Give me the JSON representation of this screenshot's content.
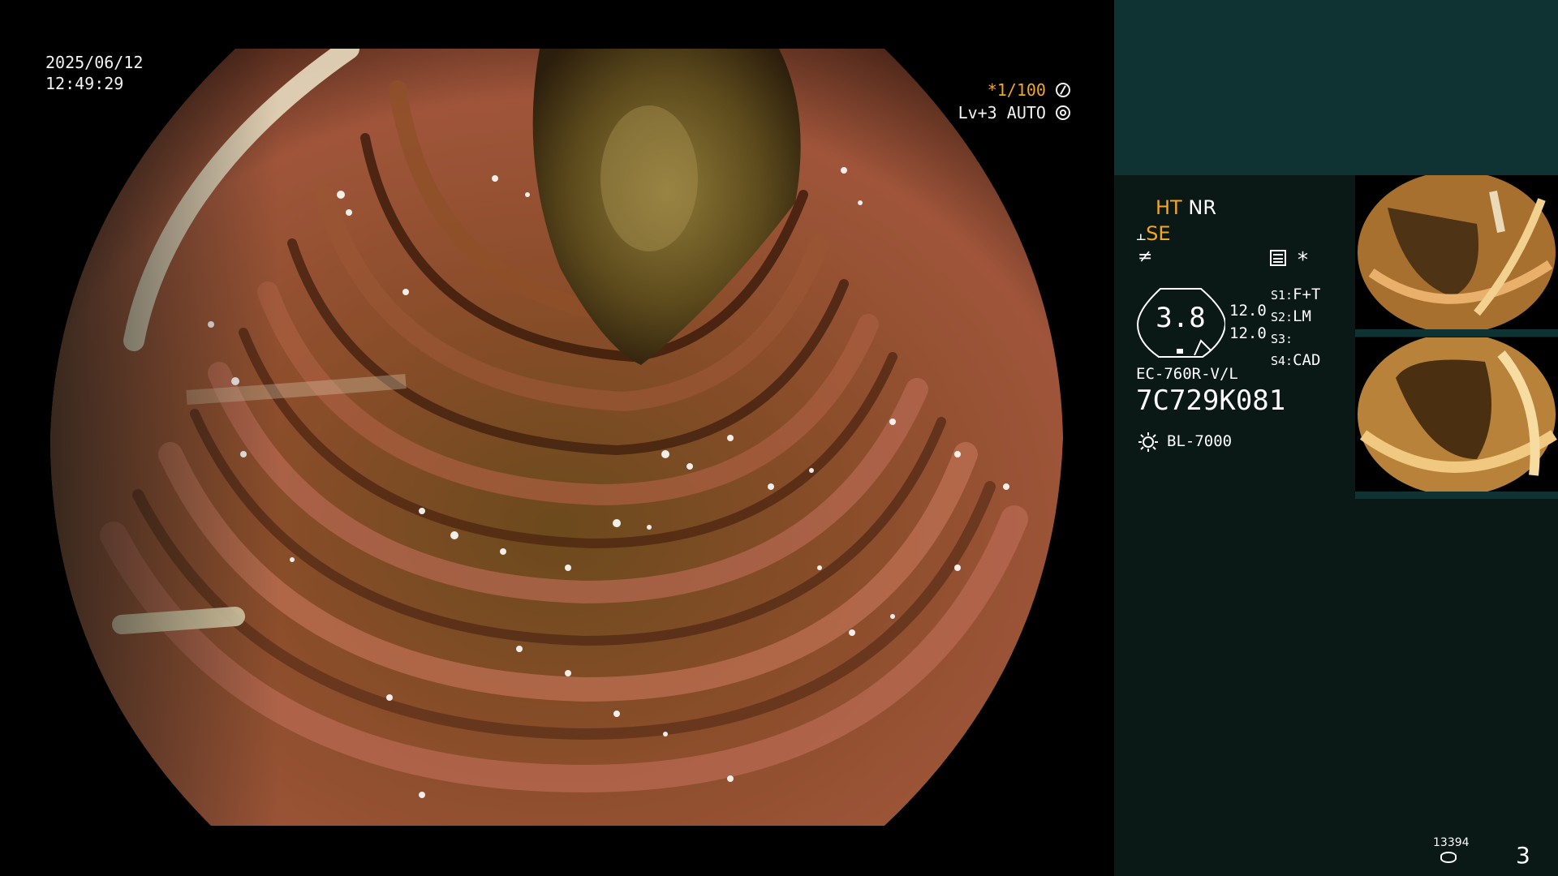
{
  "overlay": {
    "date": "2025/06/12",
    "time": "12:49:29",
    "shutter": "*1/100",
    "shutter_icon": "aperture-icon",
    "level": "Lv+3",
    "mode": "AUTO",
    "mode_icon": "iris-icon"
  },
  "panel": {
    "ht": "HT",
    "nr": "NR",
    "se": "SE",
    "se_icon": "se-symbol-icon",
    "f_icon": "f-symbol-icon",
    "memo_icon": "document-icon",
    "star": "*",
    "dial_value": "3.8",
    "values": [
      "12.0",
      "12.0"
    ],
    "switches": [
      {
        "key": "S1:",
        "value": "F+T"
      },
      {
        "key": "S2:",
        "value": "LM"
      },
      {
        "key": "S3:",
        "value": ""
      },
      {
        "key": "S4:",
        "value": "CAD"
      }
    ],
    "scope_model": "EC-760R-V/L",
    "serial": "7C729K081",
    "light_icon": "lamp-icon",
    "light_source": "BL-7000",
    "counter": "13394",
    "counter_icon": "storage-icon",
    "page": "3"
  },
  "colors": {
    "accent_amber": "#f5a623",
    "panel_top": "#0e3332",
    "panel_main": "#0a1816"
  }
}
